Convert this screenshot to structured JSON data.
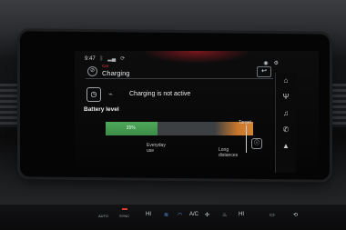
{
  "status": {
    "time": "9:47"
  },
  "header": {
    "subtitle": "Car",
    "title": "Charging"
  },
  "charging": {
    "status": "Charging is not active",
    "battery_label": "Battery level",
    "level_percent": 35,
    "level_text": "35%"
  },
  "bar_labels": {
    "target": "Target",
    "everyday_use_line1": "Everyday",
    "everyday_use_line2": "use",
    "long_distances_line1": "Long",
    "long_distances_line2": "distances"
  },
  "sidebar": {
    "items": [
      "home-icon",
      "antenna-icon",
      "music-icon",
      "phone-icon",
      "navigation-icon"
    ]
  },
  "climate": {
    "auto": "AUTO",
    "sync": "SYNC",
    "hi_left": "HI",
    "ac": "A/C",
    "hi_right": "HI"
  },
  "colors": {
    "accent_red": "#e1333c",
    "battery_green": "#3c8c47",
    "range_orange": "#d58536"
  }
}
